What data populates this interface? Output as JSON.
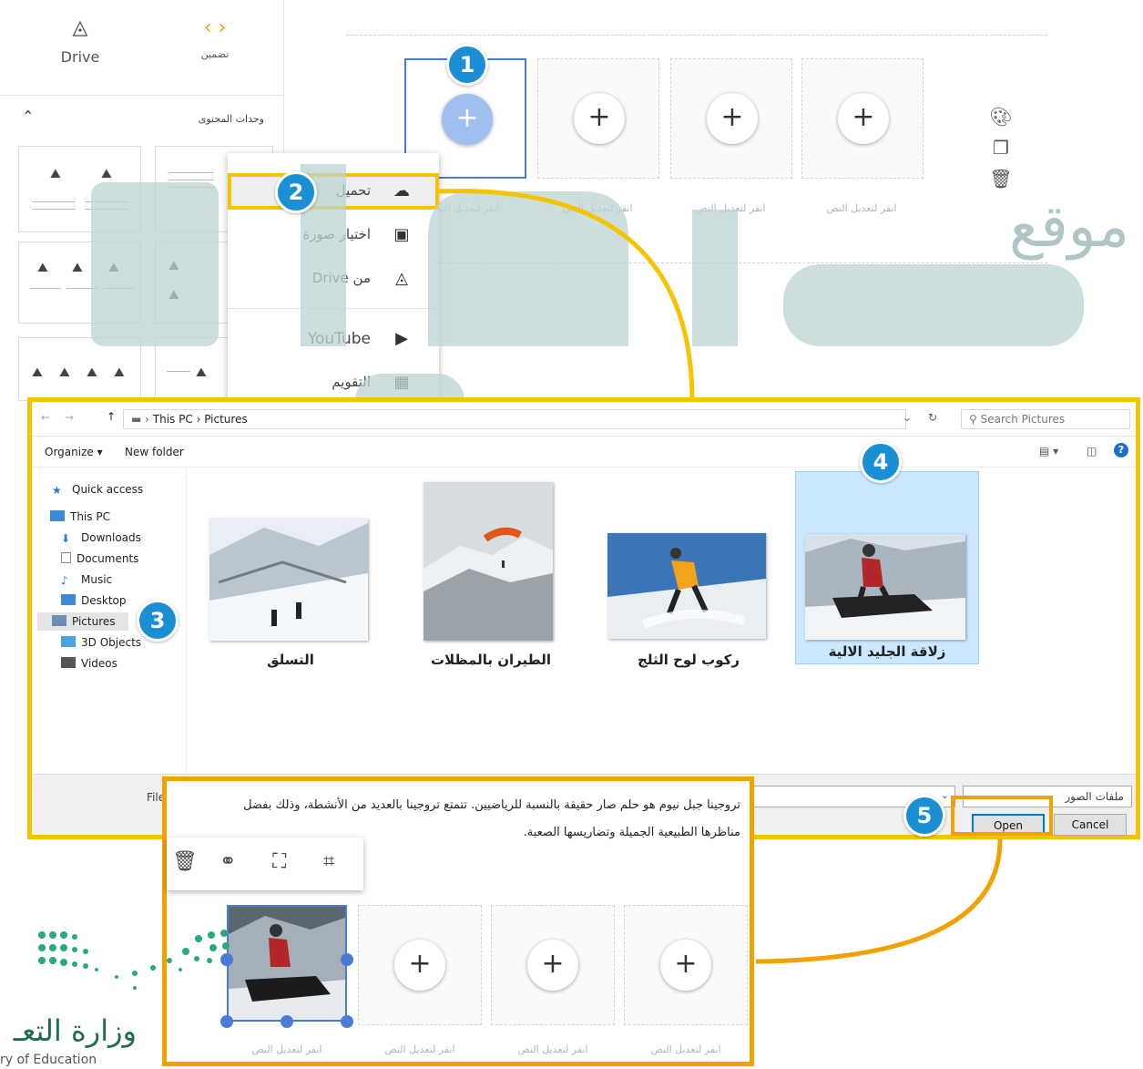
{
  "sites_editor": {
    "tabs": [
      {
        "icon": "drive-icon",
        "label": "Drive"
      },
      {
        "icon": "embed-icon",
        "label": "تضمين"
      }
    ],
    "section_title": "وحدات المحتوى",
    "placeholder_caption": "انقر لتعديل النص",
    "insert_menu": [
      {
        "icon": "cloud-upload-icon",
        "label": "تحميل"
      },
      {
        "icon": "image-icon",
        "label": "اختيار صورة"
      },
      {
        "icon": "drive-icon",
        "label": "من Drive"
      },
      {
        "icon": "youtube-icon",
        "label": "YouTube"
      },
      {
        "icon": "calendar-icon",
        "label": "التقويم"
      }
    ],
    "side_tools": [
      "palette-icon",
      "duplicate-icon",
      "delete-icon"
    ]
  },
  "file_dialog": {
    "breadcrumb": [
      "This PC",
      "Pictures"
    ],
    "search_placeholder": "Search Pictures",
    "organize_label": "Organize ▾",
    "new_folder_label": "New folder",
    "nav_items": [
      "Quick access",
      "This PC",
      "Downloads",
      "Documents",
      "Music",
      "Desktop",
      "Pictures",
      "3D Objects",
      "Videos"
    ],
    "photos": [
      {
        "label": "التسلق"
      },
      {
        "label": "الطيران بالمظلات"
      },
      {
        "label": "ركوب لوح الثلج"
      },
      {
        "label": "زلاقة الجليد الالية"
      }
    ],
    "filename_label": "File",
    "filetype_value": "ملفات الصور",
    "open_label": "Open",
    "cancel_label": "Cancel"
  },
  "steps": [
    "1",
    "2",
    "3",
    "4",
    "5"
  ],
  "result_panel": {
    "paragraph": "تروجينا جبل نيوم هو حلم صار حقيقة بالنسبة للرياضيين. تتمتع تروجينا بالعديد من الأنشطة، وذلك بفضل مناظرها الطبيعية الجميلة وتضاريسها الصعبة.",
    "image_tools": [
      "delete-icon",
      "link-icon",
      "fullscreen-icon",
      "crop-icon"
    ],
    "placeholder_caption": "انقر لتعديل النص"
  },
  "watermark": {
    "text": "موقع"
  },
  "ministry_logo": {
    "arabic": "وزارة التعـ",
    "english": "ry of Education"
  },
  "colors": {
    "step_badge": "#1a8fd3",
    "highlight_yellow": "#f5c400",
    "highlight_orange": "#f0a300",
    "watermark": "#bcd3d3"
  }
}
